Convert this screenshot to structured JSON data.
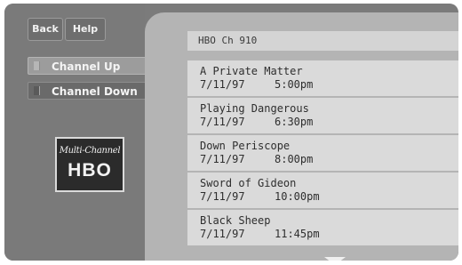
{
  "nav": {
    "back_label": "Back",
    "help_label": "Help",
    "channel_up_label": "Channel Up",
    "channel_down_label": "Channel Down"
  },
  "logo": {
    "script_text": "Multi-Channel",
    "brand_text": "HBO"
  },
  "channel": {
    "header": "HBO  Ch 910"
  },
  "listings": [
    {
      "title": "A Private Matter",
      "date": "7/11/97",
      "time": "5:00pm"
    },
    {
      "title": "Playing Dangerous",
      "date": "7/11/97",
      "time": "6:30pm"
    },
    {
      "title": "Down Periscope",
      "date": "7/11/97",
      "time": "8:00pm"
    },
    {
      "title": "Sword of Gideon",
      "date": "7/11/97",
      "time": "10:00pm"
    },
    {
      "title": "Black Sheep",
      "date": "7/11/97",
      "time": "11:45pm"
    }
  ],
  "icons": {
    "scroll": "triangle-down-icon"
  },
  "colors": {
    "panel_background": "#7b7b7b",
    "content_background": "#b4b4b4",
    "listing_background": "#dadada",
    "selected_button": "#9c9c9c"
  }
}
